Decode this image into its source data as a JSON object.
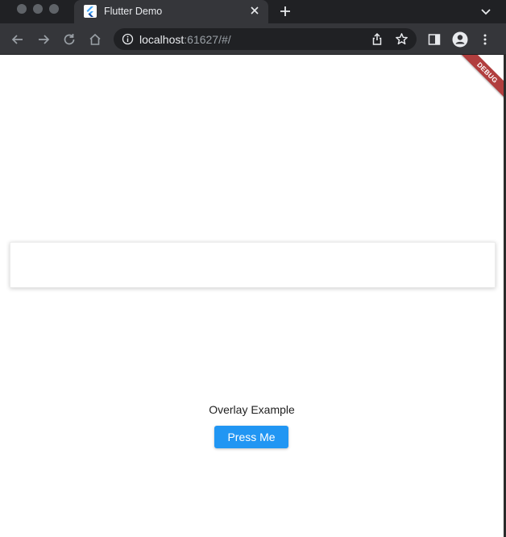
{
  "browser": {
    "tab_title": "Flutter Demo",
    "url_host": "localhost",
    "url_rest": ":61627/#/"
  },
  "page": {
    "debug_banner": "DEBUG",
    "heading": "Overlay Example",
    "button_label": "Press Me"
  },
  "colors": {
    "button": "#2196f3",
    "debug_banner": "#b13e3e"
  }
}
